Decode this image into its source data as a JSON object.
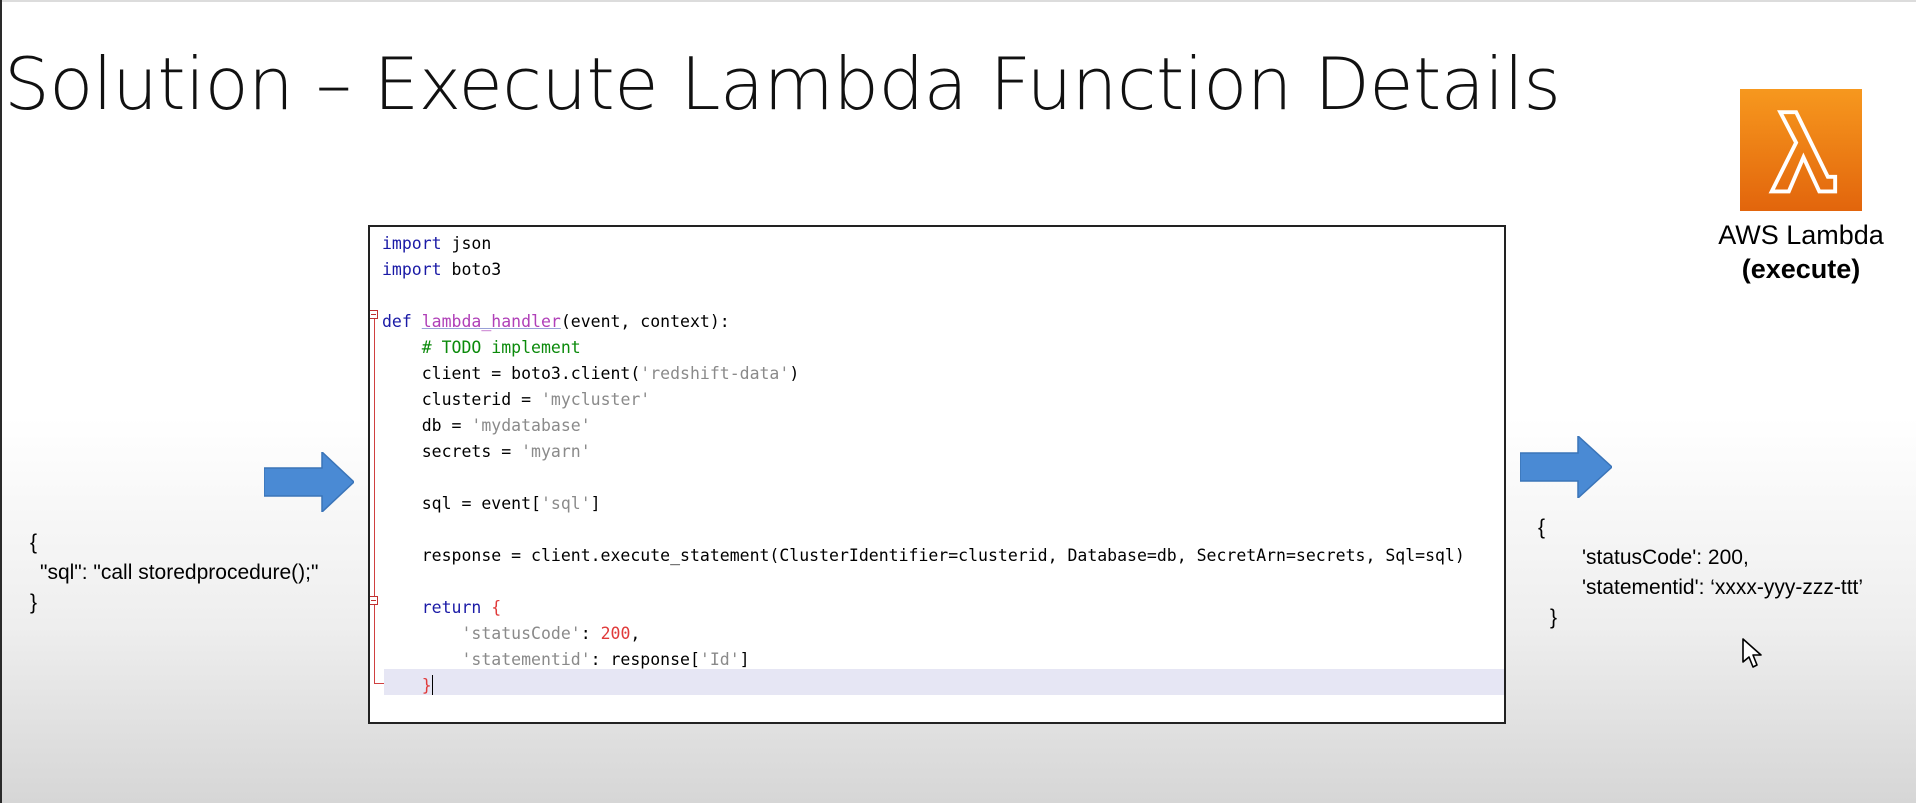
{
  "slide": {
    "title": "Solution – Execute Lambda Function Details"
  },
  "lambda": {
    "name": "AWS Lambda",
    "mode": "(execute)",
    "icon": "aws-lambda-icon",
    "colors": {
      "fill_top": "#f7981e",
      "fill_bottom": "#e2650c",
      "symbol": "#ffffff"
    }
  },
  "input_json": {
    "open": "{",
    "line": "\"sql\": \"call storedprocedure();\"",
    "close": "}"
  },
  "output_json": {
    "open": "{",
    "line1": "'statusCode': 200,",
    "line2": "'statementid': ‘xxxx-yyy-zzz-ttt’",
    "close": "}"
  },
  "arrows": {
    "color": "#4a8ad4",
    "icon": "right-arrow-icon"
  },
  "code": {
    "l1_kw": "import",
    "l1_rest": " json",
    "l2_kw": "import",
    "l2_rest": " boto3",
    "l4_kw": "def",
    "l4_sp": " ",
    "l4_fn": "lambda_handler",
    "l4_rest": "(event, context):",
    "l5_cm": "# TODO implement",
    "l6_a": "client = boto3.client(",
    "l6_s": "'redshift-data'",
    "l6_b": ")",
    "l7_a": "clusterid = ",
    "l7_s": "'mycluster'",
    "l8_a": "db = ",
    "l8_s": "'mydatabase'",
    "l9_a": "secrets = ",
    "l9_s": "'myarn'",
    "l11_a": "sql = event[",
    "l11_s": "'sql'",
    "l11_b": "]",
    "l13": "response = client.execute_statement(ClusterIdentifier=clusterid, Database=db, SecretArn=secrets, Sql=sql)",
    "l15_kw": "return",
    "l15_sp": " ",
    "l15_br": "{",
    "l16_s": "'statusCode'",
    "l16_a": ": ",
    "l16_n": "200",
    "l16_b": ",",
    "l17_s": "'statementid'",
    "l17_a": ": response[",
    "l17_s2": "'Id'",
    "l17_b": "]",
    "l18_br": "}"
  }
}
